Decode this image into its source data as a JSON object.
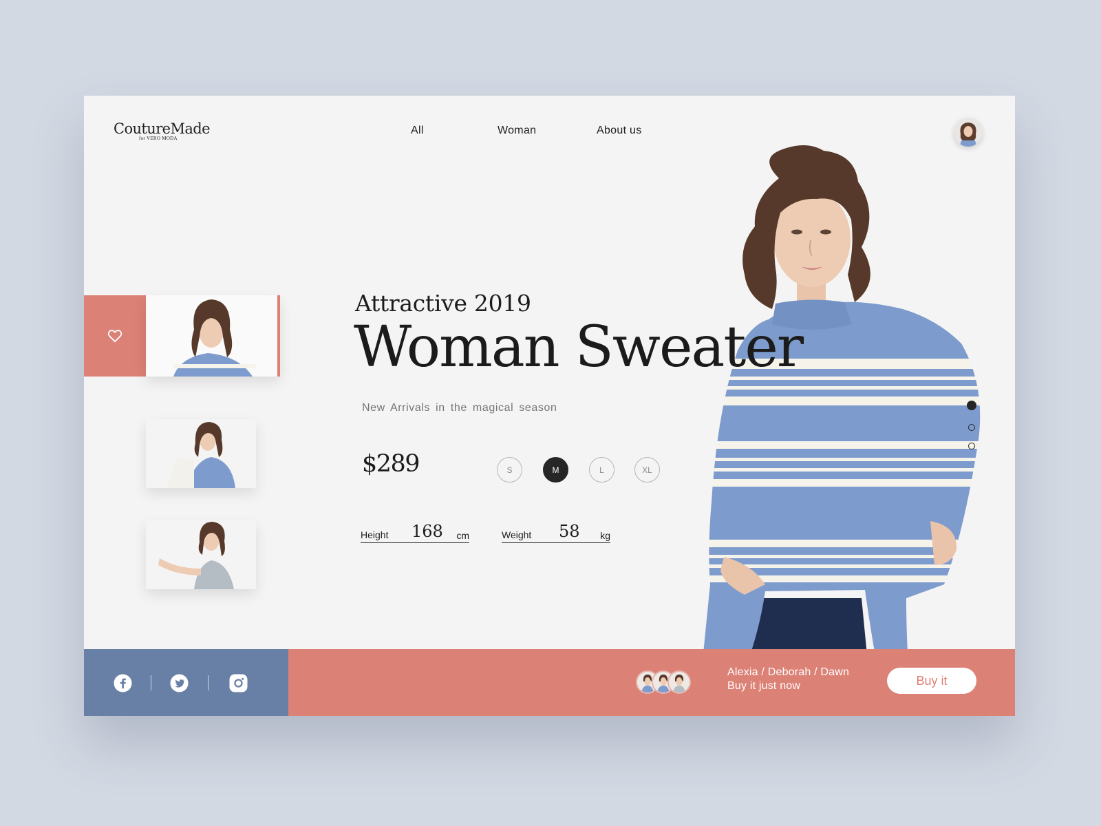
{
  "brand": {
    "name": "CoutureMade",
    "tagline": "for VERO MODA"
  },
  "nav": {
    "items": [
      "All",
      "Woman",
      "About  us"
    ]
  },
  "hero": {
    "eyebrow": "Attractive  2019",
    "title": "Woman Sweater",
    "subtitle": "New Arrivals in  the magical season",
    "price": "$289"
  },
  "sizes": {
    "options": [
      "S",
      "M",
      "L",
      "XL"
    ],
    "selected": "M"
  },
  "measurements": {
    "height": {
      "label": "Height",
      "value": "168",
      "unit": "cm"
    },
    "weight": {
      "label": "Weight",
      "value": "58",
      "unit": "kg"
    }
  },
  "gallery": {
    "count": 3,
    "active_index": 0,
    "favorite_icon": "heart-icon"
  },
  "pager": {
    "count": 3,
    "active_index": 0
  },
  "social": {
    "icons": [
      "facebook-icon",
      "twitter-icon",
      "instagram-icon"
    ]
  },
  "footer": {
    "names": "Alexia  /  Deborah  /  Dawn",
    "subtitle": "Buy it  just  now",
    "buy_label": "Buy it"
  },
  "colors": {
    "accent": "#dc8176",
    "social_bar": "#6880a6",
    "sweater": "#7d9ccd",
    "background": "#d3d9e3"
  }
}
